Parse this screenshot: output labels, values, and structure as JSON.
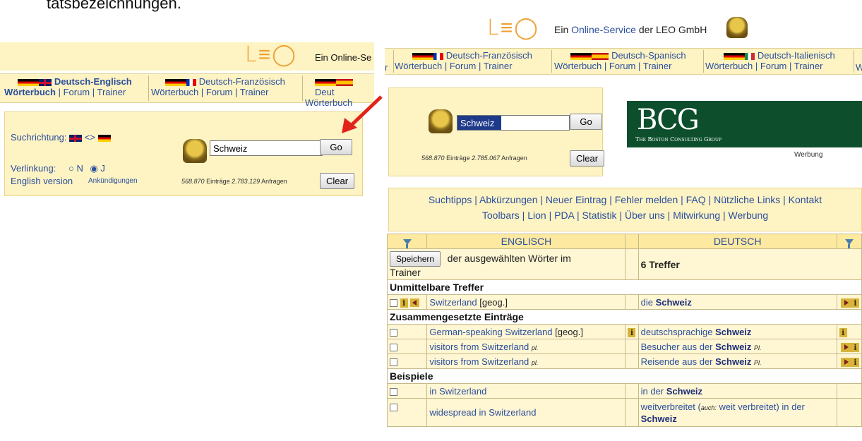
{
  "caption_fragment": "tatsbezeichnungen.",
  "left": {
    "header_text": "Ein Online-Se",
    "tabs": [
      {
        "name": "Deutsch-Englisch",
        "links": [
          "Wörterbuch",
          "Forum",
          "Trainer"
        ]
      },
      {
        "name": "Deutsch-Französisch",
        "links": [
          "Wörterbuch",
          "Forum",
          "Trainer"
        ]
      },
      {
        "name": "Deut",
        "links": [
          "Wörterbuch"
        ]
      }
    ],
    "search_direction_label": "Suchrichtung:",
    "arrow_text": "<>",
    "link_label": "Verlinkung:",
    "radio_n": "N",
    "radio_j": "J",
    "english_version": "English version",
    "announcements": "Ankündigungen",
    "search_value": "Schweiz",
    "go_label": "Go",
    "stats_entries": "568.870",
    "stats_entries_label": "Einträge",
    "stats_queries": "2.783.129",
    "stats_queries_label": "Anfragen",
    "clear_label": "Clear"
  },
  "right": {
    "header_prefix": "Ein",
    "header_link": "Online-Service",
    "header_suffix": "der LEO GmbH",
    "tabs": [
      {
        "name": "Deutsch-Französisch",
        "links": [
          "Wörterbuch",
          "Forum",
          "Trainer"
        ]
      },
      {
        "name": "Deutsch-Spanisch",
        "links": [
          "Wörterbuch",
          "Forum",
          "Trainer"
        ]
      },
      {
        "name": "Deutsch-Italienisch",
        "links": [
          "Wörterbuch",
          "Forum",
          "Trainer"
        ]
      }
    ],
    "tab_edge_prefix": "r",
    "tab_edge_suffix": "W",
    "search_value": "Schweiz",
    "go_label": "Go",
    "stats_entries": "568.870",
    "stats_entries_label": "Einträge",
    "stats_queries": "2.785.067",
    "stats_queries_label": "Anfragen",
    "clear_label": "Clear",
    "ad_logo": "BCG",
    "ad_subtitle": "The Boston Consulting Group",
    "ad_label": "Werbung",
    "nav_row1": [
      "Suchtipps",
      "Abkürzungen",
      "Neuer Eintrag",
      "Fehler melden",
      "FAQ",
      "Nützliche Links",
      "Kontakt"
    ],
    "nav_row2": [
      "Toolbars",
      "Lion",
      "PDA",
      "Statistik",
      "Über uns",
      "Mitwirkung",
      "Werbung"
    ],
    "col_english": "ENGLISCH",
    "col_deutsch": "DEUTSCH",
    "save_button": "Speichern",
    "save_text": "der ausgewählten Wörter im",
    "save_text2": "Trainer",
    "hits": "6 Treffer",
    "sections": [
      {
        "title": "Unmittelbare Treffer",
        "rows": [
          {
            "en": "Switzerland",
            "en_tag": "[geog.]",
            "de_pre": "die ",
            "de_kw": "Schweiz",
            "de_post": "",
            "de_small": ""
          }
        ]
      },
      {
        "title": "Zusammengesetzte Einträge",
        "rows": [
          {
            "en": "German-speaking Switzerland",
            "en_tag": "[geog.]",
            "de_pre": "deutschsprachige ",
            "de_kw": "Schweiz",
            "de_post": "",
            "de_small": ""
          },
          {
            "en": "visitors from Switzerland",
            "en_small": "pl.",
            "de_pre": "Besucher aus der ",
            "de_kw": "Schweiz",
            "de_small": "Pl."
          },
          {
            "en": "visitors from Switzerland",
            "en_small": "pl.",
            "de_pre": "Reisende aus der ",
            "de_kw": "Schweiz",
            "de_small": "Pl."
          }
        ]
      },
      {
        "title": "Beispiele",
        "rows": [
          {
            "en": "in Switzerland",
            "de_pre": "in der ",
            "de_kw": "Schweiz"
          },
          {
            "en": "widespread in Switzerland",
            "de_pre": "weitverbreitet (",
            "de_auch": "auch:",
            "de_mid": " weit verbreitet) in der ",
            "de_kw": "Schweiz"
          }
        ]
      }
    ]
  }
}
